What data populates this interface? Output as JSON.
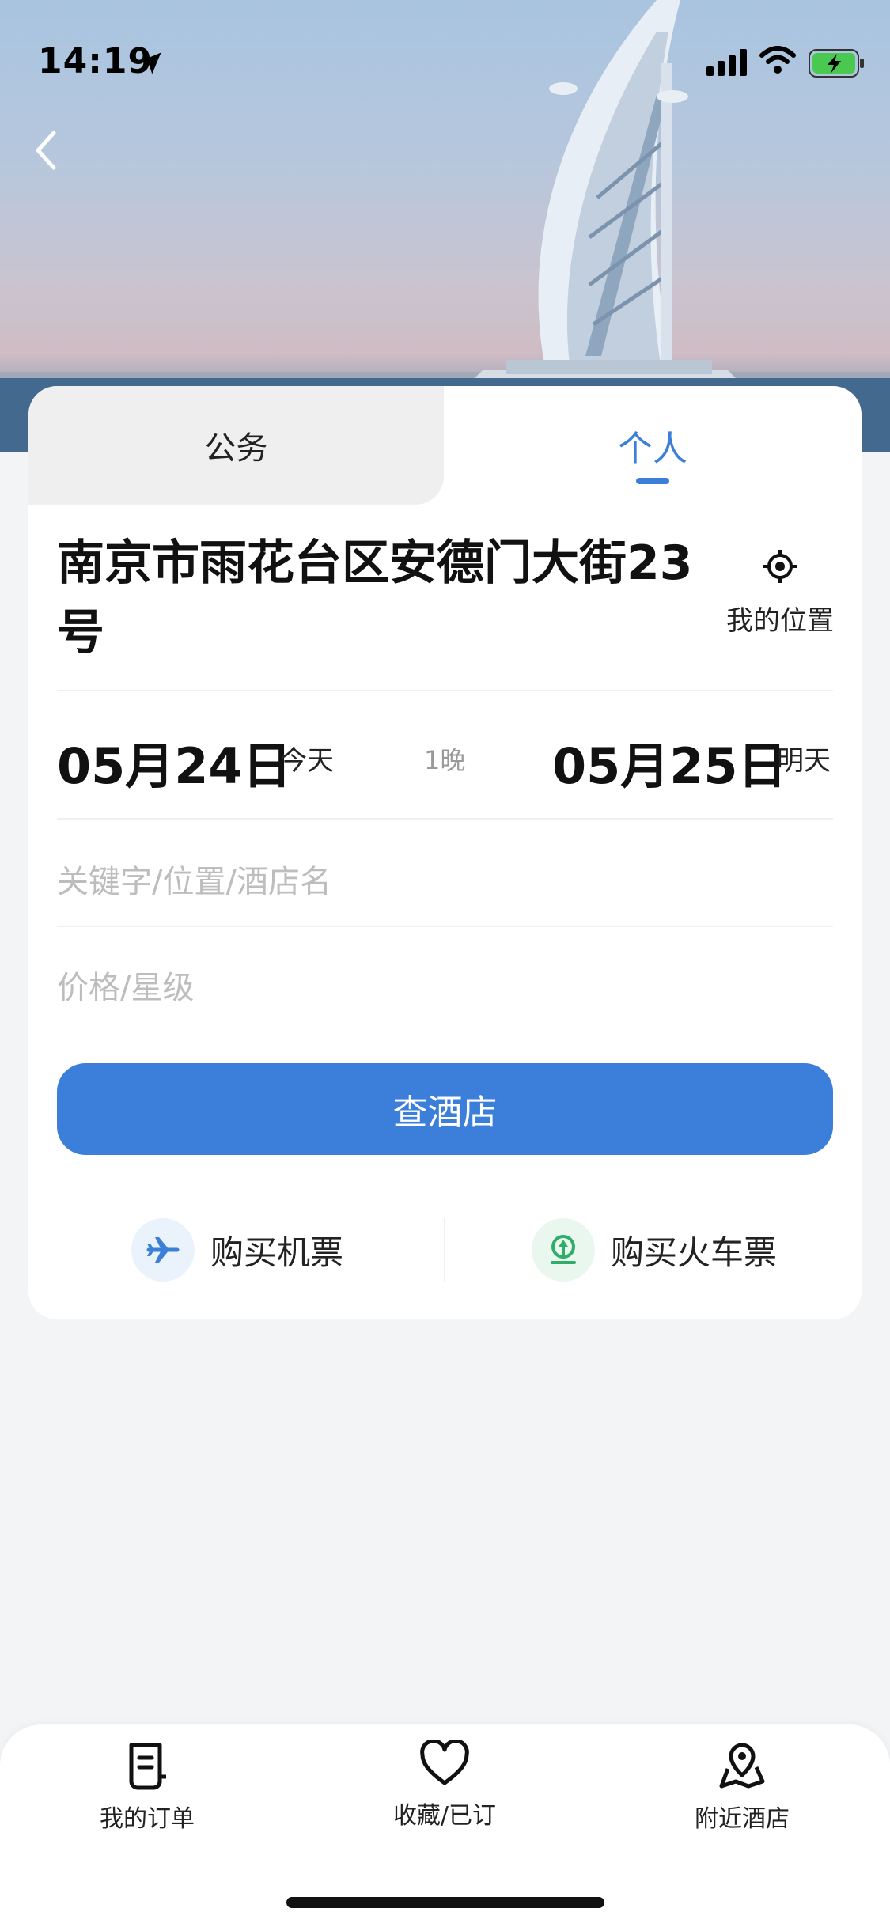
{
  "status_bar": {
    "time": "14:19",
    "icons": [
      "location-arrow-icon",
      "signal-icon",
      "wifi-icon",
      "battery-charging-icon"
    ]
  },
  "header": {
    "back_icon": "chevron-left-icon"
  },
  "tabs": [
    {
      "label": "公务",
      "active": false
    },
    {
      "label": "个人",
      "active": true
    }
  ],
  "location": {
    "address": "南京市雨花台区安德门大街23号",
    "my_location_label": "我的位置",
    "icon": "locate-icon"
  },
  "dates": {
    "check_in_date": "05月24日",
    "check_in_day": "今天",
    "nights": "1晚",
    "check_out_date": "05月25日",
    "check_out_day": "明天"
  },
  "search": {
    "keyword_placeholder": "关键字/位置/酒店名",
    "price_placeholder": "价格/星级",
    "button_label": "查酒店"
  },
  "quick_links": [
    {
      "label": "购买机票",
      "icon": "airplane-icon",
      "color": "#3b7fd9"
    },
    {
      "label": "购买火车票",
      "icon": "train-icon",
      "color": "#2fae6a"
    }
  ],
  "bottom_nav": [
    {
      "label": "我的订单",
      "icon": "order-icon"
    },
    {
      "label": "收藏/已订",
      "icon": "heart-icon"
    },
    {
      "label": "附近酒店",
      "icon": "map-pin-icon"
    }
  ],
  "colors": {
    "accent": "#3b7fdb",
    "background": "#f3f4f6",
    "train_green": "#2fae6a"
  }
}
